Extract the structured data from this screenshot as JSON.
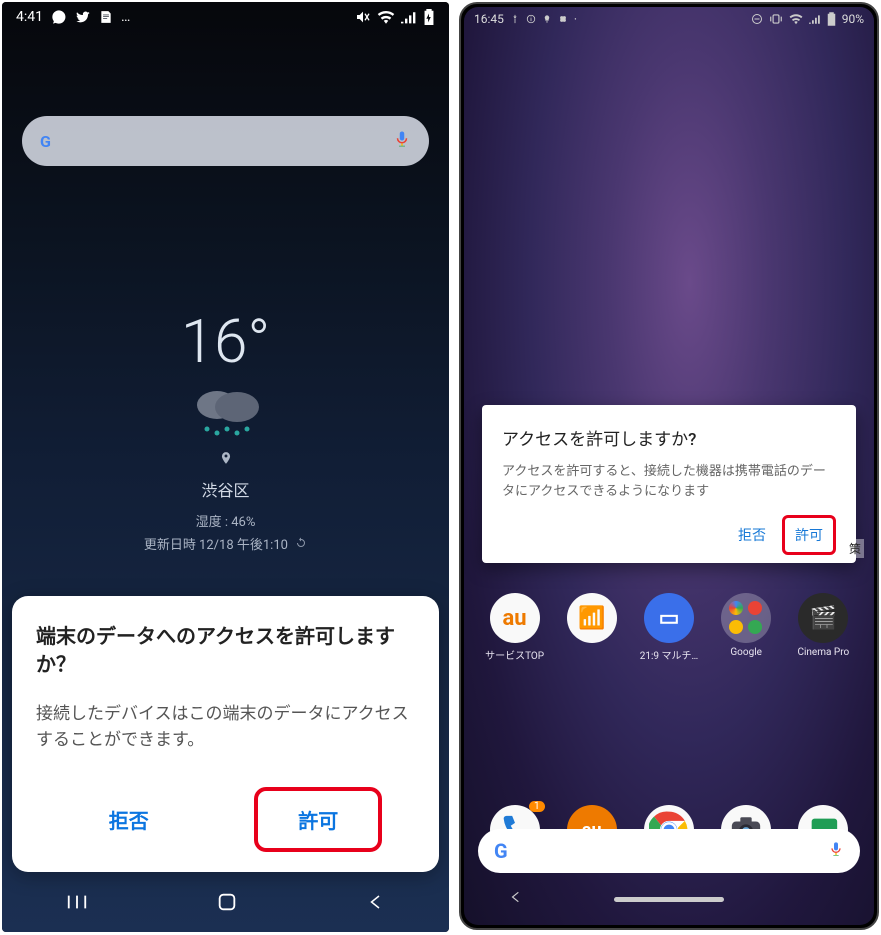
{
  "phone_a": {
    "status": {
      "time": "4:41",
      "icons_left": [
        "messenger",
        "twitter",
        "doc",
        "more"
      ],
      "icons_right": [
        "mute",
        "wifi",
        "signal",
        "battery-charging"
      ]
    },
    "weather": {
      "temperature": "16°",
      "location": "渋谷区",
      "humidity": "湿度 : 46%",
      "updated": "更新日時 12/18 午後1:10"
    },
    "dialog": {
      "title": "端末のデータへのアクセスを許可しますか？",
      "body": "接続したデバイスはこの端末のデータにアクセスすることができます。",
      "deny": "拒否",
      "allow": "許可"
    }
  },
  "phone_b": {
    "status": {
      "time": "16:45",
      "battery": "90%"
    },
    "dialog": {
      "title": "アクセスを許可しますか?",
      "body": "アクセスを許可すると、接続した機器は携帯電話のデータにアクセスできるようになります",
      "deny": "拒否",
      "allow": "許可"
    },
    "scrim_label": "策",
    "row1": [
      {
        "label": "サービスTOP",
        "color": "#f9f9f9",
        "text": "au",
        "textcolor": "#ee7a00"
      },
      {
        "label": "",
        "color": "#f9f9f9",
        "text": "📶",
        "textcolor": "#2a9a44"
      },
      {
        "label": "21:9 マルチ…",
        "color": "#3a6fea",
        "text": "▭",
        "textcolor": "#fff"
      },
      {
        "label": "Google",
        "color": "#f9f9f9",
        "text": "",
        "textcolor": ""
      },
      {
        "label": "Cinema Pro",
        "color": "#2a2a2a",
        "text": "🎬",
        "textcolor": "#caa24a"
      }
    ],
    "row2": [
      {
        "label": "",
        "color": "#f9f9f9",
        "inner": "phone"
      },
      {
        "label": "",
        "color": "#ee7a00",
        "inner": "au"
      },
      {
        "label": "",
        "color": "#f9f9f9",
        "inner": "chrome"
      },
      {
        "label": "",
        "color": "#f9f9f9",
        "inner": "camera"
      },
      {
        "label": "",
        "color": "#f9f9f9",
        "inner": "messages"
      }
    ]
  }
}
